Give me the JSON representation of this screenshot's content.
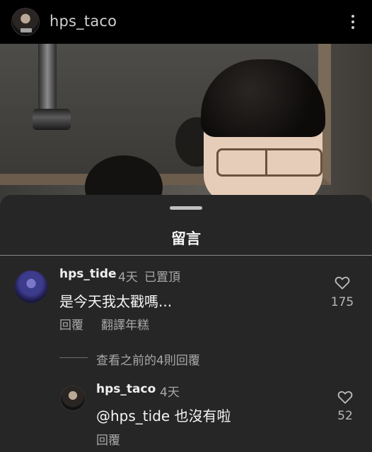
{
  "header": {
    "username": "hps_taco"
  },
  "sheet": {
    "title": "留言"
  },
  "comments": [
    {
      "username": "hps_tide",
      "time": "4天",
      "badge": "已置頂",
      "text": "是今天我太戳嗎...",
      "reply_label": "回覆",
      "translate_label": "翻譯年糕",
      "likes": "175"
    }
  ],
  "replies_toggle": "查看之前的4則回覆",
  "reply": {
    "username": "hps_taco",
    "time": "4天",
    "text": "@hps_tide 也沒有啦",
    "reply_label": "回覆",
    "likes": "52"
  },
  "colors": {
    "sheet_bg": "#262626",
    "muted": "#a8a8a8"
  }
}
